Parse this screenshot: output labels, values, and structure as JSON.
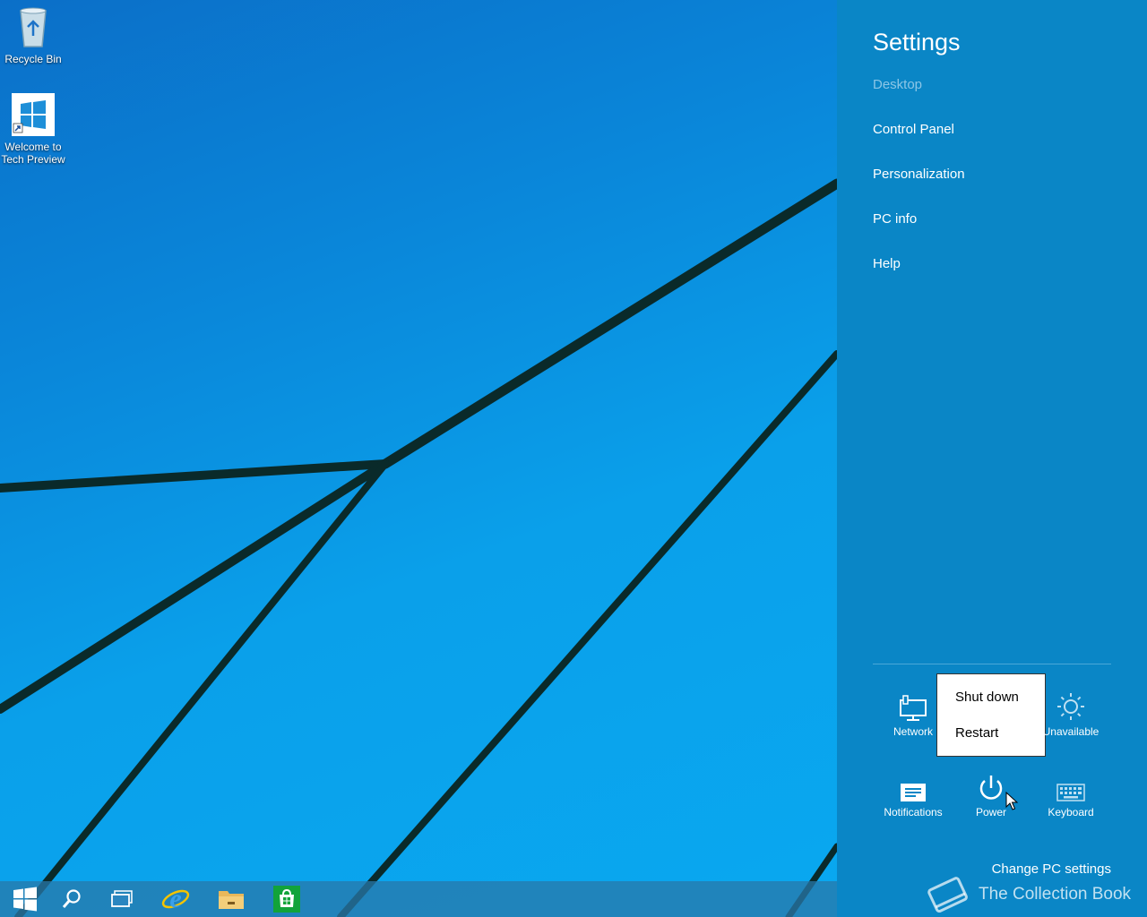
{
  "desktop": {
    "icons": [
      {
        "label": "Recycle Bin"
      },
      {
        "label": "Welcome to Tech Preview"
      }
    ]
  },
  "taskbar": {
    "items": [
      "start-icon",
      "search-icon",
      "task-view-icon",
      "internet-explorer-icon",
      "file-explorer-icon",
      "store-icon"
    ]
  },
  "settings": {
    "title": "Settings",
    "context": "Desktop",
    "links": [
      "Control Panel",
      "Personalization",
      "PC info",
      "Help"
    ],
    "tiles": {
      "network": "Network",
      "brightness": "Unavailable",
      "notifications": "Notifications",
      "power": "Power",
      "keyboard": "Keyboard"
    },
    "power_menu": {
      "shutdown": "Shut down",
      "restart": "Restart"
    },
    "change_pc_settings": "Change PC settings"
  },
  "watermark": "The Collection Book",
  "colors": {
    "settings_bg": "#0a86c6",
    "desktop_bg": "#0a9ae6",
    "disabled_text": "#8cc6e6"
  }
}
